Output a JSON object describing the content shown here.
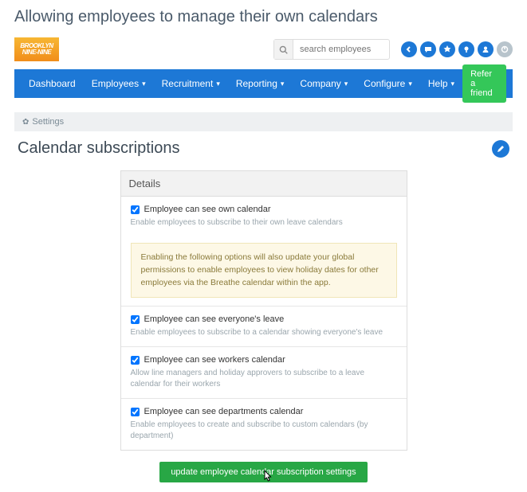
{
  "doc_title": "Allowing employees to manage their own calendars",
  "logo_text": "BROOKLYN NINE-NINE",
  "search": {
    "placeholder": "search employees"
  },
  "nav": {
    "dashboard": "Dashboard",
    "employees": "Employees",
    "recruitment": "Recruitment",
    "reporting": "Reporting",
    "company": "Company",
    "configure": "Configure",
    "help": "Help",
    "refer": "Refer a friend"
  },
  "breadcrumb": "Settings",
  "page_title": "Calendar subscriptions",
  "panel_title": "Details",
  "options": {
    "own": {
      "label": "Employee can see own calendar",
      "desc": "Enable employees to subscribe to their own leave calendars"
    },
    "alert": "Enabling the following options will also update your global permissions to enable employees to view holiday dates for other employees via the Breathe calendar within the app.",
    "everyone": {
      "label": "Employee can see everyone's leave",
      "desc": "Enable employees to subscribe to a calendar showing everyone's leave"
    },
    "workers": {
      "label": "Employee can see workers calendar",
      "desc": "Allow line managers and holiday approvers to subscribe to a leave calendar for their workers"
    },
    "departments": {
      "label": "Employee can see departments calendar",
      "desc": "Enable employees to create and subscribe to custom calendars (by department)"
    }
  },
  "update_button": "update employee calendar subscription settings"
}
